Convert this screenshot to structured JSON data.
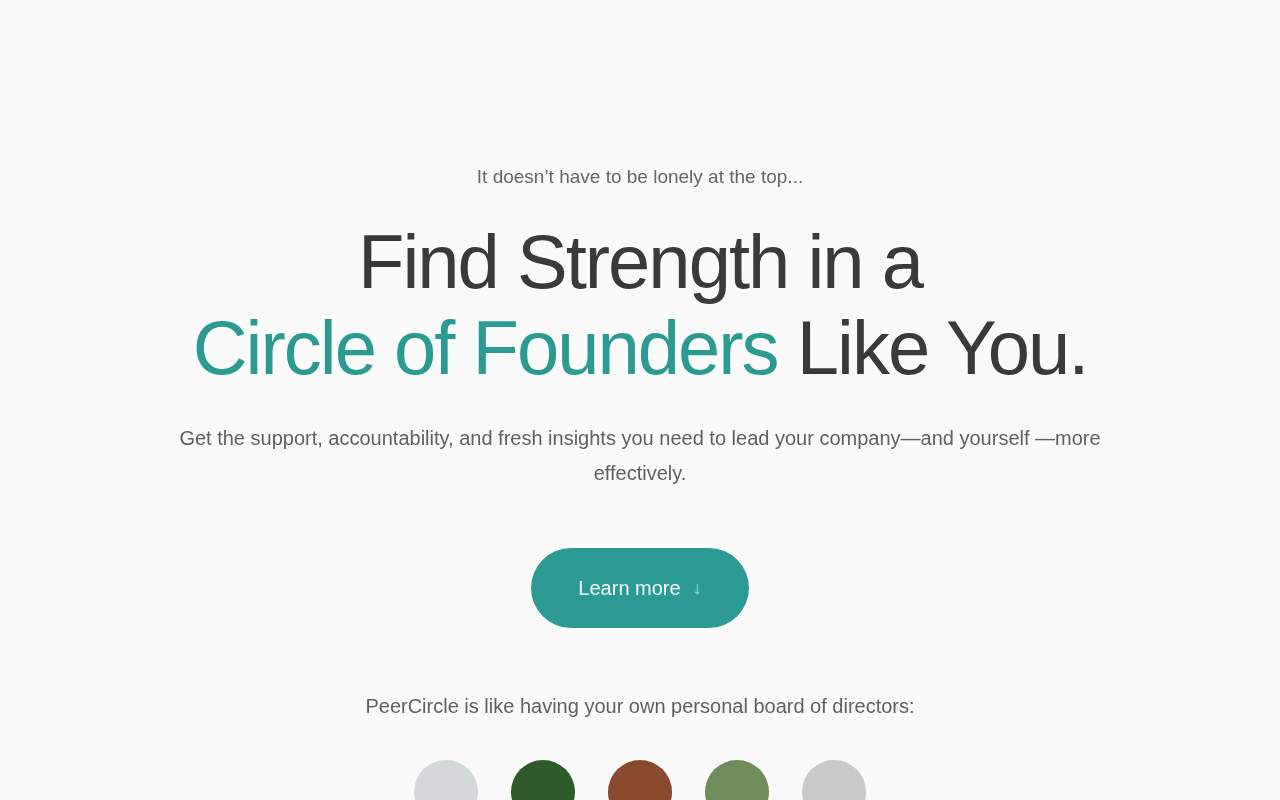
{
  "hero": {
    "eyebrow": "It doesn’t have to be lonely at the top...",
    "headline_line1": "Find Strength in a",
    "headline_accent": "Circle of Founders",
    "headline_rest": "Like You.",
    "subtitle": "Get the support, accountability, and fresh insights you need to lead your company—and yourself —more effectively.",
    "button": {
      "label": "Learn more",
      "icon": "↓"
    },
    "tagline": "PeerCircle is like having your own personal board of directors:"
  }
}
